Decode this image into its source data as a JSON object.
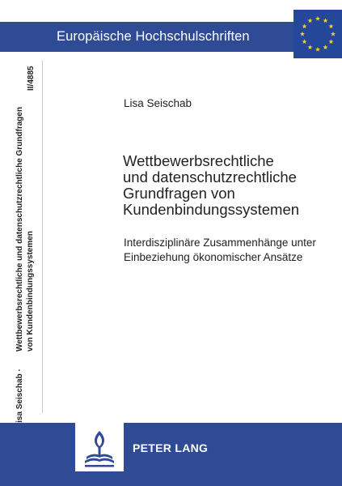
{
  "series": {
    "title": "Europäische Hochschulschriften",
    "number": "II/4885"
  },
  "author": "Lisa Seischab",
  "title_lines": [
    "Wettbewerbsrechtliche",
    "und datenschutzrechtliche",
    "Grundfragen von",
    "Kundenbindungssystemen"
  ],
  "subtitle_lines": [
    "Interdisziplinäre Zusammenhänge unter",
    "Einbeziehung ökonomischer Ansätze"
  ],
  "spine": {
    "author": "Lisa Seischab",
    "separator": "·",
    "title_line_1": "Wettbewerbsrechtliche und datenschutzrechtliche Grundfragen",
    "title_line_2": "von Kundenbindungssystemen"
  },
  "publisher": "PETER LANG",
  "colors": {
    "band": "#2f4b96",
    "flag": "#25479a",
    "stars": "#f4d32c",
    "text": "#222222"
  },
  "icons": {
    "flag": "eu-flag-icon",
    "logo": "peter-lang-logo-icon"
  }
}
